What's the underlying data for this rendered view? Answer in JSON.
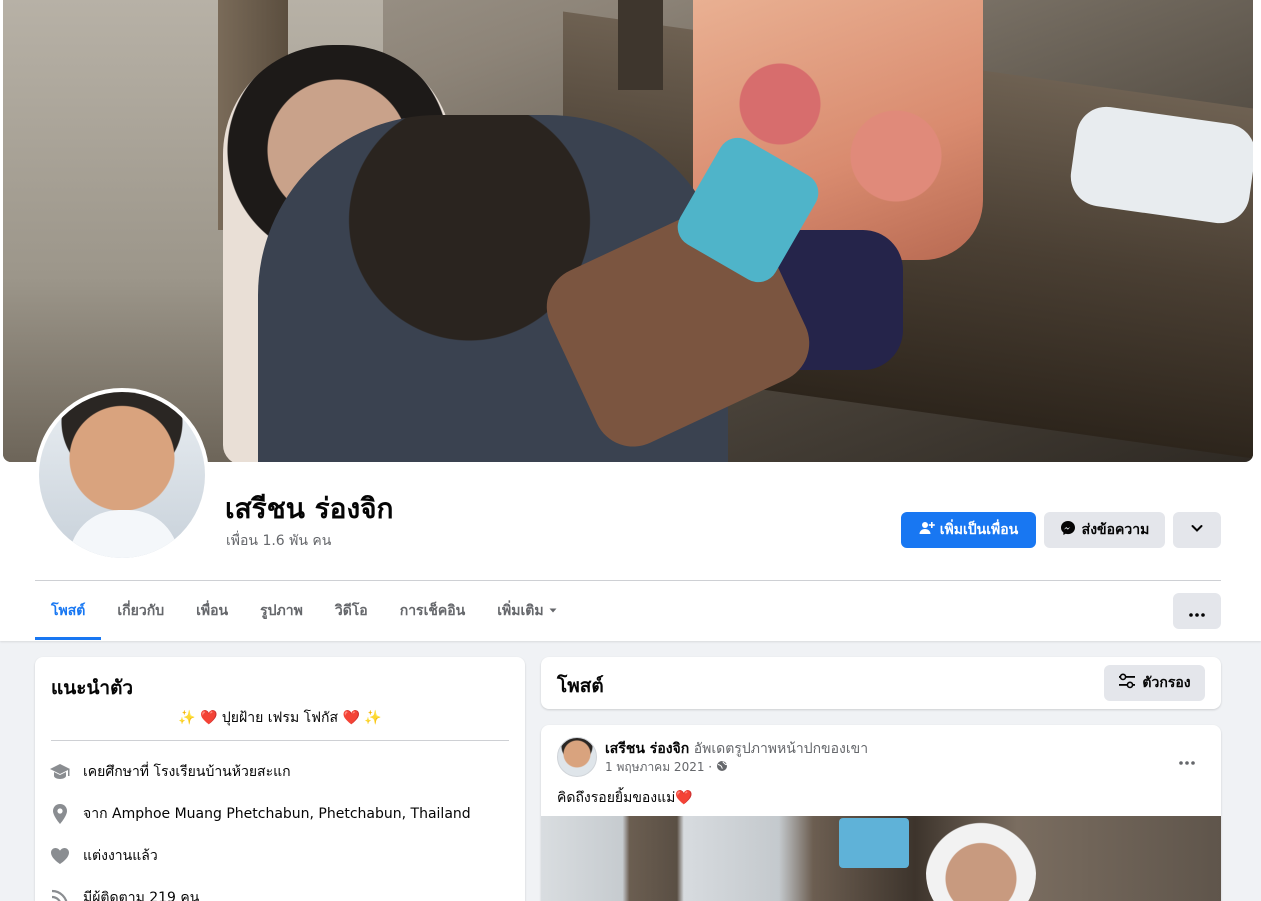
{
  "profile": {
    "name": "เสรีชน ร่องจิก",
    "friends_text": "เพื่อน 1.6 พัน คน"
  },
  "actions": {
    "add_friend": "เพิ่มเป็นเพื่อน",
    "message": "ส่งข้อความ"
  },
  "tabs": [
    {
      "label": "โพสต์"
    },
    {
      "label": "เกี่ยวกับ"
    },
    {
      "label": "เพื่อน"
    },
    {
      "label": "รูปภาพ"
    },
    {
      "label": "วิดีโอ"
    },
    {
      "label": "การเช็คอิน"
    },
    {
      "label": "เพิ่มเติม"
    }
  ],
  "intro": {
    "title": "แนะนำตัว",
    "bio": "✨ ❤️  ปุยฝ้าย เฟรม โฟกัส  ❤️ ✨",
    "items": [
      {
        "icon": "graduation-cap-icon",
        "text": "เคยศึกษาที่ โรงเรียนบ้านห้วยสะแก"
      },
      {
        "icon": "location-pin-icon",
        "text": "จาก Amphoe Muang Phetchabun, Phetchabun, Thailand"
      },
      {
        "icon": "heart-icon",
        "text": "แต่งงานแล้ว"
      },
      {
        "icon": "rss-icon",
        "text": "มีผู้ติดตาม 219 คน"
      }
    ]
  },
  "posts": {
    "title": "โพสต์",
    "filter_label": "ตัวกรอง"
  },
  "post": {
    "author": "เสรีชน ร่องจิก",
    "action": "อัพเดตรูปภาพหน้าปกของเขา",
    "date": "1 พฤษภาคม 2021 ·",
    "text": "คิดถึงรอยยิ้มของแม่❤️"
  },
  "colors": {
    "accent": "#1877f2",
    "secondary_button": "#e4e6eb",
    "page_bg": "#f0f2f5"
  }
}
